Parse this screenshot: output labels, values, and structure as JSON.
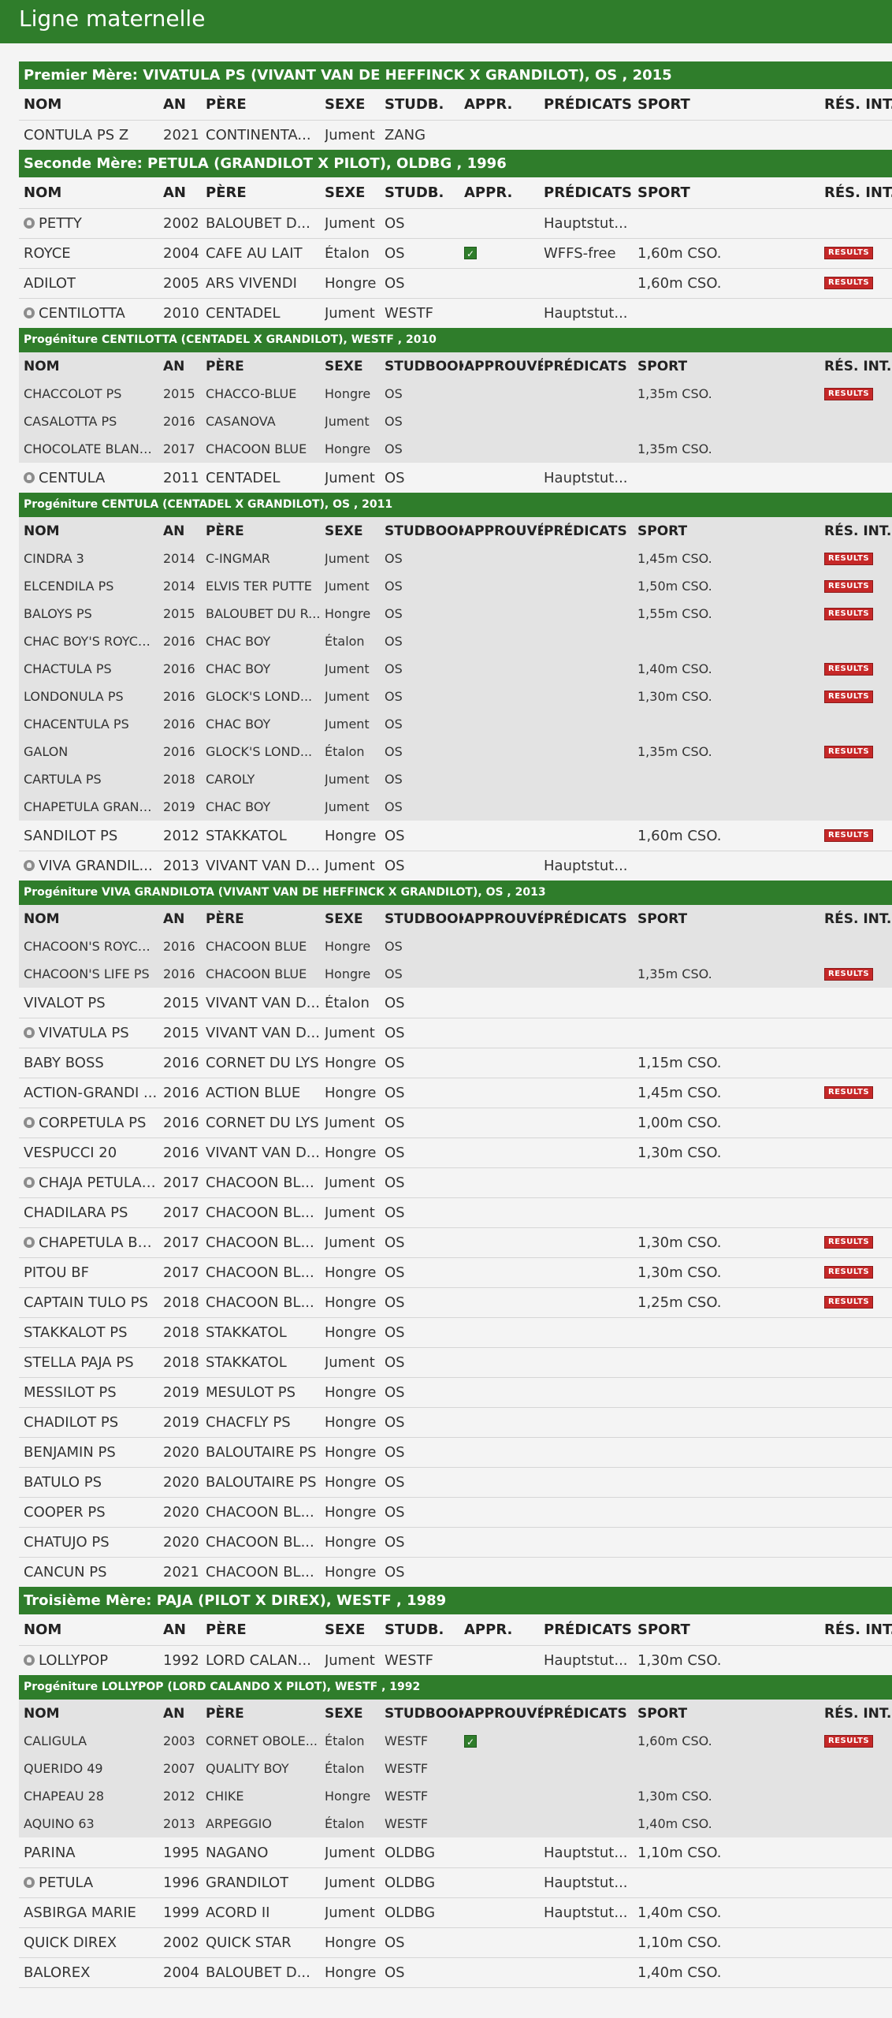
{
  "page": {
    "title": "Ligne maternelle"
  },
  "colors": {
    "header_green": "#2f7d2b",
    "progeny_bg": "#e3e3e3",
    "results_red": "#c62828"
  },
  "icons": {
    "dam": "mare-head-icon",
    "approved": "checkbox-checked-icon",
    "results": "results-badge"
  },
  "columns": {
    "main": [
      "NOM",
      "AN",
      "PÈRE",
      "SEXE",
      "STUDB.",
      "APPR.",
      "PRÉDICATS",
      "SPORT",
      "RÉS. INT."
    ],
    "progeny": [
      "NOM",
      "AN",
      "PÈRE",
      "SEXE",
      "STUDBOOK",
      "APPROUVÉ",
      "PRÉDICATS",
      "SPORT",
      "RÉS. INT."
    ]
  },
  "results_label": "RESULTS",
  "sections": [
    {
      "kind": "header",
      "title": "Premier Mère: VIVATULA PS (VIVANT VAN DE HEFFINCK X GRANDILOT), OS , 2015"
    },
    {
      "kind": "cols"
    },
    {
      "kind": "row",
      "name": "CONTULA PS Z",
      "an": "2021",
      "pere": "CONTINENTA...",
      "sexe": "Jument",
      "stud": "ZANG",
      "pred": "",
      "sport": ""
    },
    {
      "kind": "header",
      "title": "Seconde Mère: PETULA (GRANDILOT X PILOT), OLDBG , 1996"
    },
    {
      "kind": "cols"
    },
    {
      "kind": "row",
      "icon": true,
      "name": "PETTY",
      "an": "2002",
      "pere": "BALOUBET D...",
      "sexe": "Jument",
      "stud": "OS",
      "pred": "Hauptstut...",
      "sport": ""
    },
    {
      "kind": "row",
      "name": "ROYCE",
      "an": "2004",
      "pere": "CAFE AU LAIT",
      "sexe": "Étalon",
      "stud": "OS",
      "appr": true,
      "pred": "WFFS-free",
      "sport": "1,60m CSO.",
      "res": true
    },
    {
      "kind": "row",
      "name": "ADILOT",
      "an": "2005",
      "pere": "ARS VIVENDI",
      "sexe": "Hongre",
      "stud": "OS",
      "pred": "",
      "sport": "1,60m CSO.",
      "res": true
    },
    {
      "kind": "row",
      "icon": true,
      "name": "CENTILOTTA",
      "an": "2010",
      "pere": "CENTADEL",
      "sexe": "Jument",
      "stud": "WESTF",
      "pred": "Hauptstut...",
      "sport": ""
    },
    {
      "kind": "subheader",
      "title": "Progéniture  CENTILOTTA (CENTADEL X GRANDILOT), WESTF , 2010"
    },
    {
      "kind": "subcols"
    },
    {
      "kind": "grow",
      "name": "CHACCOLOT PS",
      "an": "2015",
      "pere": "CHACCO-BLUE",
      "sexe": "Hongre",
      "stud": "OS",
      "sport": "1,35m CSO.",
      "res": true
    },
    {
      "kind": "grow",
      "name": "CASALOTTA PS",
      "an": "2016",
      "pere": "CASANOVA",
      "sexe": "Jument",
      "stud": "OS",
      "sport": ""
    },
    {
      "kind": "grow",
      "name": "CHOCOLATE BLANC ...",
      "an": "2017",
      "pere": "CHACOON BLUE",
      "sexe": "Hongre",
      "stud": "OS",
      "sport": "1,35m CSO."
    },
    {
      "kind": "row",
      "icon": true,
      "name": "CENTULA",
      "an": "2011",
      "pere": "CENTADEL",
      "sexe": "Jument",
      "stud": "OS",
      "pred": "Hauptstut...",
      "sport": ""
    },
    {
      "kind": "subheader",
      "title": "Progéniture  CENTULA (CENTADEL X GRANDILOT), OS , 2011"
    },
    {
      "kind": "subcols"
    },
    {
      "kind": "grow",
      "name": "CINDRA 3",
      "an": "2014",
      "pere": "C-INGMAR",
      "sexe": "Jument",
      "stud": "OS",
      "sport": "1,45m CSO.",
      "res": true
    },
    {
      "kind": "grow",
      "name": "ELCENDILA PS",
      "an": "2014",
      "pere": "ELVIS TER PUTTE",
      "sexe": "Jument",
      "stud": "OS",
      "sport": "1,50m CSO.",
      "res": true
    },
    {
      "kind": "grow",
      "name": "BALOYS PS",
      "an": "2015",
      "pere": "BALOUBET DU R...",
      "sexe": "Hongre",
      "stud": "OS",
      "sport": "1,55m CSO.",
      "res": true
    },
    {
      "kind": "grow",
      "name": "CHAC BOY'S ROYCE ...",
      "an": "2016",
      "pere": "CHAC BOY",
      "sexe": "Étalon",
      "stud": "OS",
      "sport": ""
    },
    {
      "kind": "grow",
      "name": "CHACTULA PS",
      "an": "2016",
      "pere": "CHAC BOY",
      "sexe": "Jument",
      "stud": "OS",
      "sport": "1,40m CSO.",
      "res": true
    },
    {
      "kind": "grow",
      "name": "LONDONULA PS",
      "an": "2016",
      "pere": "GLOCK'S LOND...",
      "sexe": "Jument",
      "stud": "OS",
      "sport": "1,30m CSO.",
      "res": true
    },
    {
      "kind": "grow",
      "name": "CHACENTULA PS",
      "an": "2016",
      "pere": "CHAC BOY",
      "sexe": "Jument",
      "stud": "OS",
      "sport": ""
    },
    {
      "kind": "grow",
      "name": "GALON",
      "an": "2016",
      "pere": "GLOCK'S LOND...",
      "sexe": "Étalon",
      "stud": "OS",
      "sport": "1,35m CSO.",
      "res": true
    },
    {
      "kind": "grow",
      "name": "CARTULA PS",
      "an": "2018",
      "pere": "CAROLY",
      "sexe": "Jument",
      "stud": "OS",
      "sport": ""
    },
    {
      "kind": "grow",
      "name": "CHAPETULA GRAND...",
      "an": "2019",
      "pere": "CHAC BOY",
      "sexe": "Jument",
      "stud": "OS",
      "sport": ""
    },
    {
      "kind": "row",
      "name": "SANDILOT PS",
      "an": "2012",
      "pere": "STAKKATOL",
      "sexe": "Hongre",
      "stud": "OS",
      "pred": "",
      "sport": "1,60m CSO.",
      "res": true
    },
    {
      "kind": "row",
      "icon": true,
      "name": "VIVA GRANDIL...",
      "an": "2013",
      "pere": "VIVANT VAN D...",
      "sexe": "Jument",
      "stud": "OS",
      "pred": "Hauptstut...",
      "sport": ""
    },
    {
      "kind": "subheader",
      "title": "Progéniture  VIVA GRANDILOTA (VIVANT VAN DE HEFFINCK X GRANDILOT), OS , 2013"
    },
    {
      "kind": "subcols"
    },
    {
      "kind": "grow",
      "name": "CHACOON'S ROYCE ...",
      "an": "2016",
      "pere": "CHACOON BLUE",
      "sexe": "Hongre",
      "stud": "OS",
      "sport": ""
    },
    {
      "kind": "grow",
      "name": "CHACOON'S LIFE PS",
      "an": "2016",
      "pere": "CHACOON BLUE",
      "sexe": "Hongre",
      "stud": "OS",
      "sport": "1,35m CSO.",
      "res": true
    },
    {
      "kind": "row",
      "name": "VIVALOT PS",
      "an": "2015",
      "pere": "VIVANT VAN D...",
      "sexe": "Étalon",
      "stud": "OS",
      "pred": "",
      "sport": ""
    },
    {
      "kind": "row",
      "icon": true,
      "name": "VIVATULA PS",
      "an": "2015",
      "pere": "VIVANT VAN D...",
      "sexe": "Jument",
      "stud": "OS",
      "pred": "",
      "sport": ""
    },
    {
      "kind": "row",
      "name": "BABY BOSS",
      "an": "2016",
      "pere": "CORNET DU LYS",
      "sexe": "Hongre",
      "stud": "OS",
      "pred": "",
      "sport": "1,15m CSO."
    },
    {
      "kind": "row",
      "name": "ACTION-GRANDI ...",
      "an": "2016",
      "pere": "ACTION BLUE",
      "sexe": "Hongre",
      "stud": "OS",
      "pred": "",
      "sport": "1,45m CSO.",
      "res": true
    },
    {
      "kind": "row",
      "icon": true,
      "name": "CORPETULA PS",
      "an": "2016",
      "pere": "CORNET DU LYS",
      "sexe": "Jument",
      "stud": "OS",
      "pred": "",
      "sport": "1,00m CSO."
    },
    {
      "kind": "row",
      "name": "VESPUCCI 20",
      "an": "2016",
      "pere": "VIVANT VAN D...",
      "sexe": "Hongre",
      "stud": "OS",
      "pred": "",
      "sport": "1,30m CSO."
    },
    {
      "kind": "row",
      "icon": true,
      "name": "CHAJA PETULA ...",
      "an": "2017",
      "pere": "CHACOON BL...",
      "sexe": "Jument",
      "stud": "OS",
      "pred": "",
      "sport": ""
    },
    {
      "kind": "row",
      "name": "CHADILARA PS",
      "an": "2017",
      "pere": "CHACOON BL...",
      "sexe": "Jument",
      "stud": "OS",
      "pred": "",
      "sport": ""
    },
    {
      "kind": "row",
      "icon": true,
      "name": "CHAPETULA BL...",
      "an": "2017",
      "pere": "CHACOON BL...",
      "sexe": "Jument",
      "stud": "OS",
      "pred": "",
      "sport": "1,30m CSO.",
      "res": true
    },
    {
      "kind": "row",
      "name": "PITOU BF",
      "an": "2017",
      "pere": "CHACOON BL...",
      "sexe": "Hongre",
      "stud": "OS",
      "pred": "",
      "sport": "1,30m CSO.",
      "res": true
    },
    {
      "kind": "row",
      "name": "CAPTAIN TULO PS",
      "an": "2018",
      "pere": "CHACOON BL...",
      "sexe": "Hongre",
      "stud": "OS",
      "pred": "",
      "sport": "1,25m CSO.",
      "res": true
    },
    {
      "kind": "row",
      "name": "STAKKALOT PS",
      "an": "2018",
      "pere": "STAKKATOL",
      "sexe": "Hongre",
      "stud": "OS",
      "pred": "",
      "sport": ""
    },
    {
      "kind": "row",
      "name": "STELLA PAJA PS",
      "an": "2018",
      "pere": "STAKKATOL",
      "sexe": "Jument",
      "stud": "OS",
      "pred": "",
      "sport": ""
    },
    {
      "kind": "row",
      "name": "MESSILOT PS",
      "an": "2019",
      "pere": "MESULOT PS",
      "sexe": "Hongre",
      "stud": "OS",
      "pred": "",
      "sport": ""
    },
    {
      "kind": "row",
      "name": "CHADILOT PS",
      "an": "2019",
      "pere": "CHACFLY PS",
      "sexe": "Hongre",
      "stud": "OS",
      "pred": "",
      "sport": ""
    },
    {
      "kind": "row",
      "name": "BENJAMIN PS",
      "an": "2020",
      "pere": "BALOUTAIRE PS",
      "sexe": "Hongre",
      "stud": "OS",
      "pred": "",
      "sport": ""
    },
    {
      "kind": "row",
      "name": "BATULO PS",
      "an": "2020",
      "pere": "BALOUTAIRE PS",
      "sexe": "Hongre",
      "stud": "OS",
      "pred": "",
      "sport": ""
    },
    {
      "kind": "row",
      "name": "COOPER PS",
      "an": "2020",
      "pere": "CHACOON BL...",
      "sexe": "Hongre",
      "stud": "OS",
      "pred": "",
      "sport": ""
    },
    {
      "kind": "row",
      "name": "CHATUJO PS",
      "an": "2020",
      "pere": "CHACOON BL...",
      "sexe": "Hongre",
      "stud": "OS",
      "pred": "",
      "sport": ""
    },
    {
      "kind": "row",
      "name": "CANCUN PS",
      "an": "2021",
      "pere": "CHACOON BL...",
      "sexe": "Hongre",
      "stud": "OS",
      "pred": "",
      "sport": ""
    },
    {
      "kind": "header",
      "title": "Troisième Mère: PAJA (PILOT X DIREX), WESTF , 1989"
    },
    {
      "kind": "cols"
    },
    {
      "kind": "row",
      "icon": true,
      "name": "LOLLYPOP",
      "an": "1992",
      "pere": "LORD CALAN...",
      "sexe": "Jument",
      "stud": "WESTF",
      "pred": "Hauptstut...",
      "sport": "1,30m CSO."
    },
    {
      "kind": "subheader",
      "title": "Progéniture  LOLLYPOP (LORD CALANDO X PILOT), WESTF , 1992"
    },
    {
      "kind": "subcols"
    },
    {
      "kind": "grow",
      "name": "CALIGULA",
      "an": "2003",
      "pere": "CORNET OBOLE...",
      "sexe": "Étalon",
      "stud": "WESTF",
      "appr": true,
      "sport": "1,60m CSO.",
      "res": true
    },
    {
      "kind": "grow",
      "name": "QUERIDO 49",
      "an": "2007",
      "pere": "QUALITY BOY",
      "sexe": "Étalon",
      "stud": "WESTF",
      "sport": ""
    },
    {
      "kind": "grow",
      "name": "CHAPEAU 28",
      "an": "2012",
      "pere": "CHIKE",
      "sexe": "Hongre",
      "stud": "WESTF",
      "sport": "1,30m CSO."
    },
    {
      "kind": "grow",
      "name": "AQUINO 63",
      "an": "2013",
      "pere": "ARPEGGIO",
      "sexe": "Étalon",
      "stud": "WESTF",
      "sport": "1,40m CSO."
    },
    {
      "kind": "row",
      "name": "PARINA",
      "an": "1995",
      "pere": "NAGANO",
      "sexe": "Jument",
      "stud": "OLDBG",
      "pred": "Hauptstut...",
      "sport": "1,10m CSO."
    },
    {
      "kind": "row",
      "icon": true,
      "name": "PETULA",
      "an": "1996",
      "pere": "GRANDILOT",
      "sexe": "Jument",
      "stud": "OLDBG",
      "pred": "Hauptstut...",
      "sport": ""
    },
    {
      "kind": "row",
      "name": "ASBIRGA MARIE",
      "an": "1999",
      "pere": "ACORD II",
      "sexe": "Jument",
      "stud": "OLDBG",
      "pred": "Hauptstut...",
      "sport": "1,40m CSO."
    },
    {
      "kind": "row",
      "name": "QUICK DIREX",
      "an": "2002",
      "pere": "QUICK STAR",
      "sexe": "Hongre",
      "stud": "OS",
      "pred": "",
      "sport": "1,10m CSO."
    },
    {
      "kind": "row",
      "name": "BALOREX",
      "an": "2004",
      "pere": "BALOUBET D...",
      "sexe": "Hongre",
      "stud": "OS",
      "pred": "",
      "sport": "1,40m CSO."
    }
  ]
}
